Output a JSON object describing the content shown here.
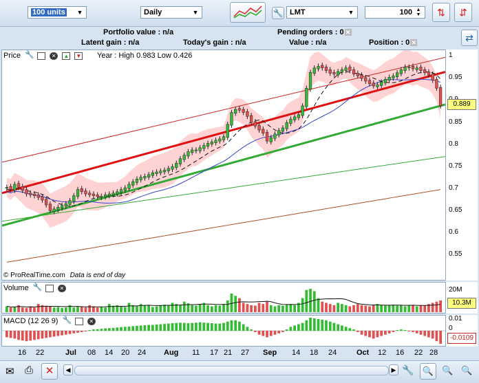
{
  "toolbar": {
    "quantity_select": "100 units",
    "period_select": "Daily",
    "symbol": "LMT",
    "order_qty": "100"
  },
  "info": {
    "portfolio_value": "Portfolio value : n/a",
    "latent_gain": "Latent gain : n/a",
    "todays_gain": "Today's gain : n/a",
    "pending_orders": "Pending orders : 0",
    "value": "Value : n/a",
    "position": "Position : 0"
  },
  "price_panel": {
    "title": "Price",
    "range_text": "Year : High 0.983 Low 0.426",
    "copyright": "© ProRealTime.com",
    "eod_note": "Data is end of day",
    "last_price": "0.889",
    "y_ticks": [
      "1",
      "0.95",
      "0.9",
      "0.85",
      "0.8",
      "0.75",
      "0.7",
      "0.65",
      "0.6",
      "0.55"
    ]
  },
  "volume_panel": {
    "title": "Volume",
    "y_tick": "20M",
    "last_value": "10.3M"
  },
  "macd_panel": {
    "title": "MACD (12 26 9)",
    "y_tick": "0.01",
    "zero_tick": "0",
    "last_value": "-0.0109"
  },
  "x_axis": {
    "labels": [
      "16",
      "22",
      "Jul",
      "08",
      "14",
      "20",
      "24",
      "Aug",
      "11",
      "17",
      "21",
      "27",
      "Sep",
      "14",
      "18",
      "24",
      "Oct",
      "12",
      "16",
      "22",
      "28"
    ],
    "bold": [
      "Jul",
      "Aug",
      "Sep",
      "Oct"
    ]
  },
  "colors": {
    "up": "#33bb33",
    "down": "#e05050",
    "band": "#ffc8c8",
    "channel_red": "#e01010",
    "channel_green": "#33aa33"
  },
  "chart_data": {
    "type": "candlestick",
    "title": "",
    "ylim": [
      0.52,
      1.01
    ],
    "trend": [
      0.705,
      0.7,
      0.712,
      0.705,
      0.698,
      0.69,
      0.688,
      0.686,
      0.682,
      0.676,
      0.665,
      0.652,
      0.656,
      0.66,
      0.664,
      0.668,
      0.675,
      0.686,
      0.7,
      0.695,
      0.69,
      0.688,
      0.686,
      0.684,
      0.685,
      0.688,
      0.69,
      0.692,
      0.695,
      0.7,
      0.704,
      0.712,
      0.718,
      0.724,
      0.728,
      0.73,
      0.734,
      0.738,
      0.74,
      0.742,
      0.744,
      0.748,
      0.752,
      0.76,
      0.77,
      0.778,
      0.786,
      0.79,
      0.79,
      0.795,
      0.8,
      0.805,
      0.808,
      0.812,
      0.815,
      0.82,
      0.848,
      0.875,
      0.882,
      0.88,
      0.875,
      0.866,
      0.852,
      0.844,
      0.835,
      0.828,
      0.81,
      0.818,
      0.826,
      0.834,
      0.84,
      0.852,
      0.86,
      0.865,
      0.87,
      0.89,
      0.93,
      0.966,
      0.976,
      0.98,
      0.976,
      0.97,
      0.964,
      0.962,
      0.968,
      0.972,
      0.976,
      0.97,
      0.962,
      0.958,
      0.952,
      0.946,
      0.94,
      0.935,
      0.938,
      0.944,
      0.95,
      0.955,
      0.958,
      0.965,
      0.972,
      0.978,
      0.978,
      0.974,
      0.976,
      0.97,
      0.965,
      0.96,
      0.948,
      0.93,
      0.89
    ],
    "volume_pct": [
      0.25,
      0.2,
      0.22,
      0.3,
      0.2,
      0.18,
      0.25,
      0.2,
      0.35,
      0.3,
      0.28,
      0.25,
      0.2,
      0.22,
      0.18,
      0.2,
      0.3,
      0.2,
      0.22,
      0.25,
      0.2,
      0.3,
      0.25,
      0.2,
      0.22,
      0.2,
      0.35,
      0.28,
      0.3,
      0.25,
      0.22,
      0.4,
      0.3,
      0.25,
      0.35,
      0.28,
      0.3,
      0.22,
      0.25,
      0.3,
      0.32,
      0.28,
      0.4,
      0.35,
      0.3,
      0.45,
      0.38,
      0.3,
      0.28,
      0.35,
      0.4,
      0.3,
      0.25,
      0.3,
      0.28,
      0.35,
      0.5,
      0.8,
      0.7,
      0.6,
      0.4,
      0.35,
      0.3,
      0.28,
      0.4,
      0.35,
      0.45,
      0.3,
      0.25,
      0.3,
      0.28,
      0.32,
      0.35,
      0.3,
      0.4,
      0.6,
      0.95,
      1.0,
      0.9,
      0.6,
      0.45,
      0.4,
      0.35,
      0.3,
      0.4,
      0.35,
      0.3,
      0.25,
      0.3,
      0.35,
      0.3,
      0.28,
      0.25,
      0.3,
      0.35,
      0.3,
      0.28,
      0.3,
      0.32,
      0.28,
      0.3,
      0.25,
      0.3,
      0.28,
      0.25,
      0.3,
      0.28,
      0.35,
      0.4,
      0.45,
      0.5
    ],
    "macd_hist": [
      -0.5,
      -0.55,
      -0.6,
      -0.7,
      -0.75,
      -0.8,
      -0.75,
      -0.7,
      -0.65,
      -0.6,
      -0.55,
      -0.5,
      -0.45,
      -0.4,
      -0.35,
      -0.3,
      -0.25,
      -0.2,
      -0.15,
      -0.1,
      -0.05,
      0.05,
      0.1,
      0.12,
      0.15,
      0.18,
      0.2,
      0.22,
      0.25,
      0.28,
      0.3,
      0.32,
      0.35,
      0.38,
      0.4,
      0.42,
      0.45,
      0.45,
      0.48,
      0.5,
      0.52,
      0.55,
      0.58,
      0.6,
      0.62,
      0.6,
      0.58,
      0.6,
      0.62,
      0.65,
      0.62,
      0.6,
      0.58,
      0.55,
      0.55,
      0.6,
      0.7,
      0.8,
      0.8,
      0.7,
      0.5,
      0.3,
      0.1,
      -0.1,
      -0.3,
      -0.4,
      -0.5,
      -0.4,
      -0.3,
      -0.2,
      -0.1,
      0.1,
      0.3,
      0.4,
      0.5,
      0.6,
      0.8,
      1.0,
      0.95,
      0.9,
      0.85,
      0.8,
      0.7,
      0.6,
      0.5,
      0.4,
      0.3,
      0.2,
      0.1,
      -0.1,
      -0.3,
      -0.4,
      -0.5,
      -0.6,
      -0.5,
      -0.4,
      -0.3,
      -0.2,
      -0.1,
      0.05,
      0.1,
      0.05,
      -0.05,
      -0.1,
      -0.2,
      -0.3,
      -0.4,
      -0.5,
      -0.6,
      -0.8,
      -1.0
    ],
    "channel": {
      "upper_thin": [
        0.762,
        1.0
      ],
      "red": [
        0.692,
        0.967
      ],
      "green": [
        0.618,
        0.893
      ],
      "lower_thin": [
        0.628,
        0.775
      ]
    }
  }
}
